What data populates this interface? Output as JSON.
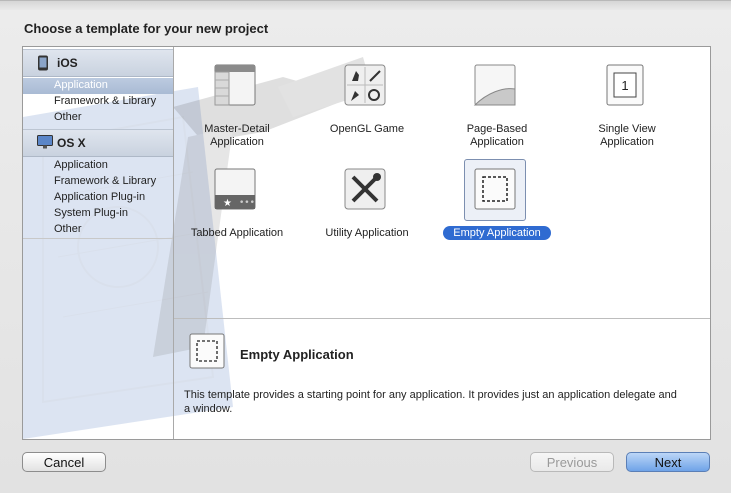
{
  "dialog": {
    "title": "Choose a template for your new project"
  },
  "sidebar": {
    "sections": [
      {
        "name": "iOS",
        "icon": "iphone-icon",
        "items": [
          "Application",
          "Framework & Library",
          "Other"
        ]
      },
      {
        "name": "OS X",
        "icon": "mac-app-icon",
        "items": [
          "Application",
          "Framework & Library",
          "Application Plug-in",
          "System Plug-in",
          "Other"
        ]
      }
    ],
    "selected": "iOS > Application"
  },
  "templates": [
    {
      "label_line1": "Master-Detail",
      "label_line2": "Application",
      "icon": "master-detail-icon"
    },
    {
      "label_line1": "OpenGL Game",
      "label_line2": "",
      "icon": "opengl-game-icon"
    },
    {
      "label_line1": "Page-Based",
      "label_line2": "Application",
      "icon": "page-curl-icon"
    },
    {
      "label_line1": "Single View",
      "label_line2": "Application",
      "icon": "single-view-icon"
    },
    {
      "label_line1": "Tabbed Application",
      "label_line2": "",
      "icon": "tabbed-icon"
    },
    {
      "label_line1": "Utility Application",
      "label_line2": "",
      "icon": "utility-tools-icon"
    },
    {
      "label_line1": "Empty Application",
      "label_line2": "",
      "icon": "empty-dashed-icon",
      "selected": true
    }
  ],
  "detail": {
    "title": "Empty Application",
    "description": "This template provides a starting point for any application. It provides just an application delegate and a window."
  },
  "buttons": {
    "cancel": "Cancel",
    "previous": "Previous",
    "next": "Next"
  },
  "colors": {
    "selection_blue": "#2f6bd1",
    "sidebar_selection": "#a9bbd4"
  }
}
